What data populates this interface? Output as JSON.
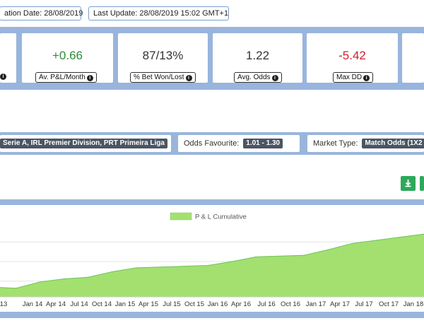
{
  "header": {
    "creation_date": "ation Date: 28/08/2019",
    "last_update": "Last Update: 28/08/2019 15:02 GMT+1"
  },
  "stats": [
    {
      "value": "+0.66",
      "label": "Av. P&L/Month",
      "color": "#2e8b3a"
    },
    {
      "value": "87/13%",
      "label": "% Bet Won/Lost",
      "color": "#333333"
    },
    {
      "value": "1.22",
      "label": "Avg. Odds",
      "color": "#333333"
    },
    {
      "value": "-5.42",
      "label": "Max DD",
      "color": "#d0202e"
    }
  ],
  "filters": {
    "leagues_value": "Serie A, IRL Premier Division, PRT Primeira Liga",
    "odds_label": "Odds Favourite:",
    "odds_value": "1.01 - 1.30",
    "market_label": "Market Type:",
    "market_value": "Match Odds (1X2"
  },
  "buttons": {
    "download_icon": "download-icon",
    "color": "#2ea85a"
  },
  "chart_data": {
    "type": "area",
    "legend": "P & L Cumulative",
    "legend_position": "top-center",
    "series_color": "#a3e070",
    "x_ticks": [
      "13",
      "Jan 14",
      "Apr 14",
      "Jul 14",
      "Oct 14",
      "Jan 15",
      "Apr 15",
      "Jul 15",
      "Oct 15",
      "Jan 16",
      "Apr 16",
      "Jul 16",
      "Oct 16",
      "Jan 17",
      "Apr 17",
      "Jul 17",
      "Oct 17",
      "Jan 18"
    ],
    "x": [
      0,
      2,
      5,
      8,
      11,
      14,
      17,
      20,
      23,
      26,
      29,
      32,
      35,
      38,
      41,
      44,
      47,
      50,
      53
    ],
    "y": [
      -0.8,
      -0.9,
      -0.1,
      0.3,
      0.5,
      1.2,
      1.7,
      1.8,
      1.9,
      2.0,
      2.5,
      3.1,
      3.2,
      3.3,
      4.0,
      4.8,
      5.2,
      5.6,
      6.0
    ],
    "grid": true
  }
}
